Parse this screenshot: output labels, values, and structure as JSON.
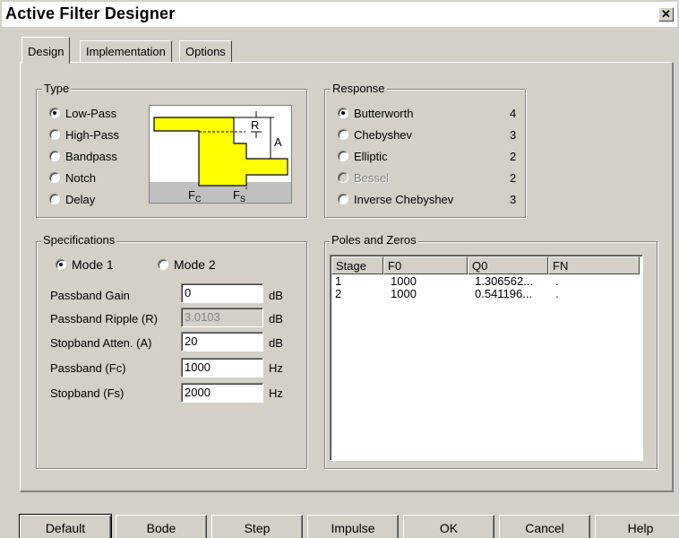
{
  "window": {
    "title": "Active Filter Designer",
    "close_glyph": "✕"
  },
  "tabs": [
    {
      "label": "Design",
      "active": true
    },
    {
      "label": "Implementation",
      "active": false
    },
    {
      "label": "Options",
      "active": false
    }
  ],
  "type_group": {
    "label": "Type",
    "options": [
      "Low-Pass",
      "High-Pass",
      "Bandpass",
      "Notch",
      "Delay"
    ],
    "selected": "Low-Pass",
    "diagram": {
      "r_label": "R",
      "a_label": "A",
      "fc_label": "F",
      "fc_sub": "C",
      "fs_label": "F",
      "fs_sub": "S",
      "colors": {
        "fill": "#ffff00",
        "stopband": "#c0c0c0",
        "outline": "#000000"
      }
    }
  },
  "response_group": {
    "label": "Response",
    "options": [
      {
        "label": "Butterworth",
        "order": "4",
        "selected": true,
        "enabled": true
      },
      {
        "label": "Chebyshev",
        "order": "3",
        "selected": false,
        "enabled": true
      },
      {
        "label": "Elliptic",
        "order": "2",
        "selected": false,
        "enabled": true
      },
      {
        "label": "Bessel",
        "order": "2",
        "selected": false,
        "enabled": false
      },
      {
        "label": "Inverse Chebyshev",
        "order": "3",
        "selected": false,
        "enabled": true
      }
    ]
  },
  "spec_group": {
    "label": "Specifications",
    "modes": [
      "Mode 1",
      "Mode 2"
    ],
    "selected_mode": "Mode 1",
    "rows": [
      {
        "label": "Passband Gain",
        "value": "0",
        "unit": "dB",
        "enabled": true
      },
      {
        "label": "Passband Ripple (R)",
        "value": "3.0103",
        "unit": "dB",
        "enabled": false
      },
      {
        "label": "Stopband Atten. (A)",
        "value": "20",
        "unit": "dB",
        "enabled": true
      },
      {
        "label": "Passband (Fc)",
        "value": "1000",
        "unit": "Hz",
        "enabled": true
      },
      {
        "label": "Stopband (Fs)",
        "value": "2000",
        "unit": "Hz",
        "enabled": true
      }
    ]
  },
  "poles_group": {
    "label": "Poles and Zeros",
    "columns": [
      "Stage",
      "F0",
      "Q0",
      "FN"
    ],
    "rows": [
      [
        "1",
        "1000",
        "1.306562...",
        "."
      ],
      [
        "2",
        "1000",
        "0.541196...",
        "."
      ]
    ]
  },
  "buttons": [
    "Default",
    "Bode",
    "Step",
    "Impulse",
    "OK",
    "Cancel",
    "Help"
  ],
  "colors": {
    "face": "#d4d0c8",
    "title_bg": "#ffffff"
  }
}
